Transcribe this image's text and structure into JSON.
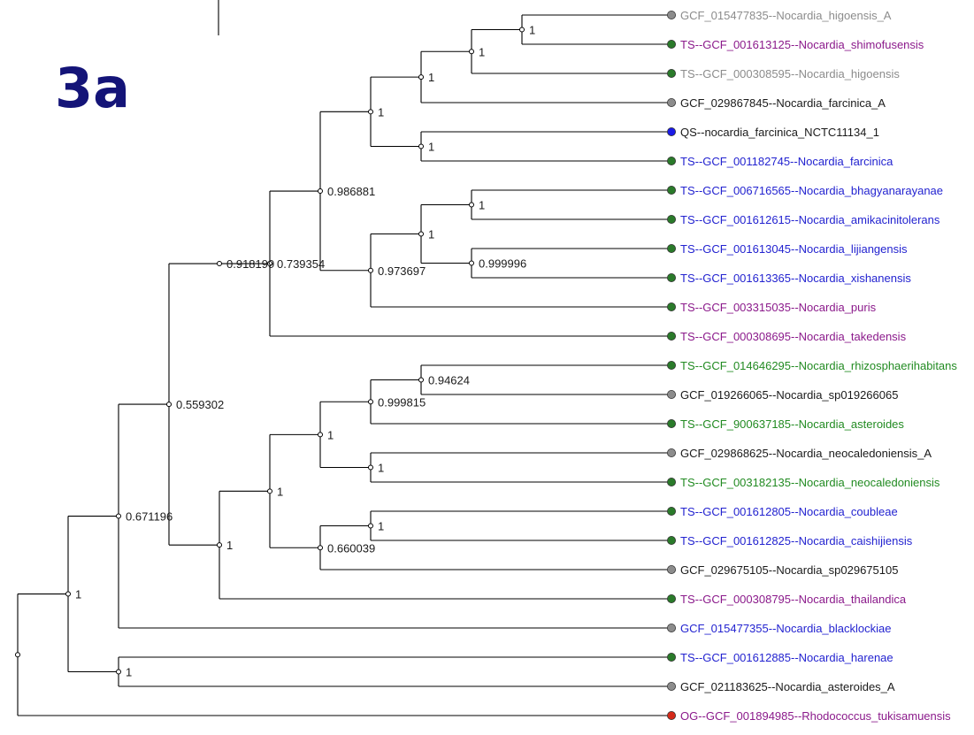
{
  "panel_label": "3a",
  "colors": {
    "panel_label": "#141478",
    "branch": "#000000",
    "dot_fill": {
      "gray": "#8c8c8c",
      "green": "#2a7a2a",
      "blue": "#1a1ae6",
      "red": "#d42a1a"
    },
    "label": {
      "gray": "#8c8c8c",
      "black": "#1a1a1a",
      "purple": "#8b1a8b",
      "blue": "#2323d0",
      "green": "#228b22"
    }
  },
  "tree": {
    "type": "phylogenetic_tree",
    "orientation": "left-to-right",
    "root": {
      "children": [
        {
          "support": "1",
          "children": [
            {
              "support": "0.671196",
              "children": [
                {
                  "support": "0.559302",
                  "children": [
                    {
                      "support": "0.918199",
                      "children": [
                        {
                          "support": "0.739354",
                          "children": [
                            {
                              "support": "0.986881",
                              "children": [
                                {
                                  "support": "1",
                                  "children": [
                                    {
                                      "support": "1",
                                      "children": [
                                        {
                                          "support": "1",
                                          "children": [
                                            {
                                              "support": "1",
                                              "children": [
                                                {
                                                  "label": "GCF_015477835--Nocardia_higoensis_A",
                                                  "dot": "gray",
                                                  "label_color": "gray"
                                                },
                                                {
                                                  "label": "TS--GCF_001613125--Nocardia_shimofusensis",
                                                  "dot": "green",
                                                  "label_color": "purple"
                                                }
                                              ]
                                            },
                                            {
                                              "label": "TS--GCF_000308595--Nocardia_higoensis",
                                              "dot": "green",
                                              "label_color": "gray"
                                            }
                                          ]
                                        },
                                        {
                                          "label": "GCF_029867845--Nocardia_farcinica_A",
                                          "dot": "gray",
                                          "label_color": "black"
                                        }
                                      ]
                                    },
                                    {
                                      "support": "1",
                                      "children": [
                                        {
                                          "label": "QS--nocardia_farcinica_NCTC11134_1",
                                          "dot": "blue",
                                          "label_color": "black"
                                        },
                                        {
                                          "label": "TS--GCF_001182745--Nocardia_farcinica",
                                          "dot": "green",
                                          "label_color": "blue"
                                        }
                                      ]
                                    }
                                  ]
                                },
                                {
                                  "support": "0.973697",
                                  "children": [
                                    {
                                      "support": "1",
                                      "children": [
                                        {
                                          "support": "1",
                                          "children": [
                                            {
                                              "label": "TS--GCF_006716565--Nocardia_bhagyanarayanae",
                                              "dot": "green",
                                              "label_color": "blue"
                                            },
                                            {
                                              "label": "TS--GCF_001612615--Nocardia_amikacinitolerans",
                                              "dot": "green",
                                              "label_color": "blue"
                                            }
                                          ]
                                        },
                                        {
                                          "support": "0.999996",
                                          "children": [
                                            {
                                              "label": "TS--GCF_001613045--Nocardia_lijiangensis",
                                              "dot": "green",
                                              "label_color": "blue"
                                            },
                                            {
                                              "label": "TS--GCF_001613365--Nocardia_xishanensis",
                                              "dot": "green",
                                              "label_color": "blue"
                                            }
                                          ]
                                        }
                                      ]
                                    },
                                    {
                                      "label": "TS--GCF_003315035--Nocardia_puris",
                                      "dot": "green",
                                      "label_color": "purple"
                                    }
                                  ]
                                }
                              ]
                            },
                            {
                              "label": "TS--GCF_000308695--Nocardia_takedensis",
                              "dot": "green",
                              "label_color": "purple"
                            }
                          ]
                        }
                      ]
                    },
                    {
                      "support": "1",
                      "children": [
                        {
                          "support": "1",
                          "children": [
                            {
                              "support": "1",
                              "children": [
                                {
                                  "support": "0.999815",
                                  "children": [
                                    {
                                      "support": "0.94624",
                                      "children": [
                                        {
                                          "label": "TS--GCF_014646295--Nocardia_rhizosphaerihabitans",
                                          "dot": "green",
                                          "label_color": "green"
                                        },
                                        {
                                          "label": "GCF_019266065--Nocardia_sp019266065",
                                          "dot": "gray",
                                          "label_color": "black"
                                        }
                                      ]
                                    },
                                    {
                                      "label": "TS--GCF_900637185--Nocardia_asteroides",
                                      "dot": "green",
                                      "label_color": "green"
                                    }
                                  ]
                                },
                                {
                                  "support": "1",
                                  "children": [
                                    {
                                      "label": "GCF_029868625--Nocardia_neocaledoniensis_A",
                                      "dot": "gray",
                                      "label_color": "black"
                                    },
                                    {
                                      "label": "TS--GCF_003182135--Nocardia_neocaledoniensis",
                                      "dot": "green",
                                      "label_color": "green"
                                    }
                                  ]
                                }
                              ]
                            },
                            {
                              "support": "0.660039",
                              "children": [
                                {
                                  "support": "1",
                                  "children": [
                                    {
                                      "label": "TS--GCF_001612805--Nocardia_coubleae",
                                      "dot": "green",
                                      "label_color": "blue"
                                    },
                                    {
                                      "label": "TS--GCF_001612825--Nocardia_caishijiensis",
                                      "dot": "green",
                                      "label_color": "blue"
                                    }
                                  ]
                                },
                                {
                                  "label": "GCF_029675105--Nocardia_sp029675105",
                                  "dot": "gray",
                                  "label_color": "black"
                                }
                              ]
                            }
                          ]
                        },
                        {
                          "label": "TS--GCF_000308795--Nocardia_thailandica",
                          "dot": "green",
                          "label_color": "purple"
                        }
                      ]
                    }
                  ]
                },
                {
                  "label": "GCF_015477355--Nocardia_blacklockiae",
                  "dot": "gray",
                  "label_color": "blue"
                }
              ]
            },
            {
              "support": "1",
              "children": [
                {
                  "label": "TS--GCF_001612885--Nocardia_harenae",
                  "dot": "green",
                  "label_color": "blue"
                },
                {
                  "label": "GCF_021183625--Nocardia_asteroides_A",
                  "dot": "gray",
                  "label_color": "black"
                }
              ]
            }
          ]
        },
        {
          "label": "OG--GCF_001894985--Rhodococcus_tukisamuensis",
          "dot": "red",
          "label_color": "purple"
        }
      ]
    }
  }
}
